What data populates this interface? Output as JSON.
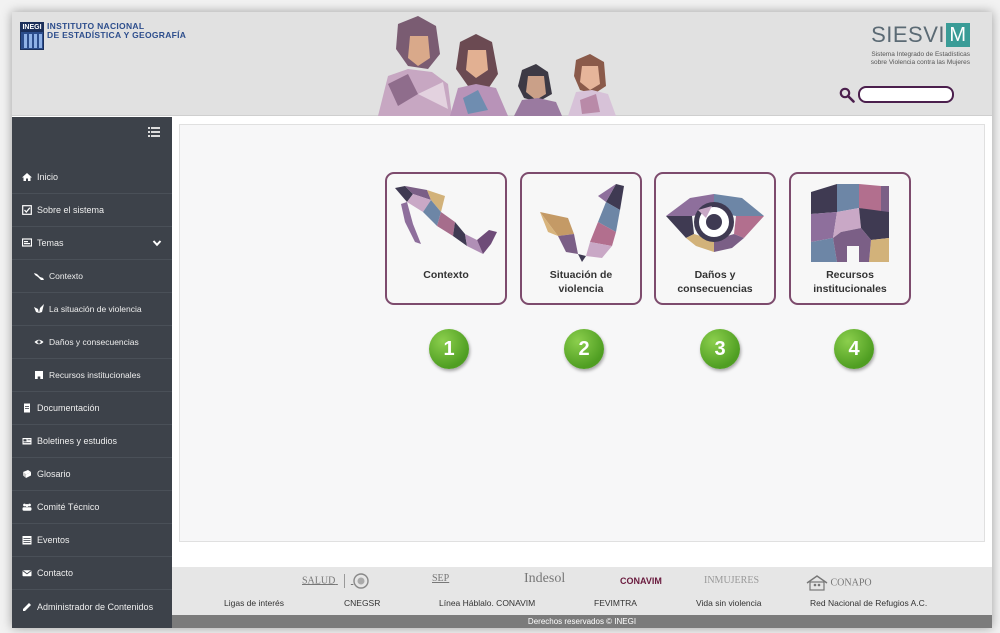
{
  "header": {
    "inegi_line1": "INSTITUTO NACIONAL",
    "inegi_line2": "DE ESTADÍSTICA Y GEOGRAFÍA",
    "inegi_mark": "INEGI",
    "siesvim_title": "SIESVI",
    "siesvim_m": "M",
    "siesvim_sub1": "Sistema Integrado de Estadísticas",
    "siesvim_sub2": "sobre Violencia contra las Mujeres",
    "search_value": "",
    "search_placeholder": ""
  },
  "sidebar": {
    "items": [
      {
        "label": "Inicio",
        "icon": "home-icon"
      },
      {
        "label": "Sobre el sistema",
        "icon": "checkbox-icon"
      },
      {
        "label": "Temas",
        "icon": "topics-icon"
      },
      {
        "label": "Contexto",
        "icon": "map-icon"
      },
      {
        "label": "La situación de violencia",
        "icon": "butterfly-icon"
      },
      {
        "label": "Daños y consecuencias",
        "icon": "eye-icon"
      },
      {
        "label": "Recursos institucionales",
        "icon": "building-icon"
      },
      {
        "label": "Documentación",
        "icon": "document-icon"
      },
      {
        "label": "Boletines y estudios",
        "icon": "newspaper-icon"
      },
      {
        "label": "Glosario",
        "icon": "book-icon"
      },
      {
        "label": "Comité Técnico",
        "icon": "people-icon"
      },
      {
        "label": "Eventos",
        "icon": "calendar-icon"
      },
      {
        "label": "Contacto",
        "icon": "envelope-icon"
      },
      {
        "label": "Administrador de Contenidos",
        "icon": "pencil-icon"
      }
    ]
  },
  "cards": [
    {
      "label_line1": "Contexto",
      "label_line2": "",
      "number": "1"
    },
    {
      "label_line1": "Situación de",
      "label_line2": "violencia",
      "number": "2"
    },
    {
      "label_line1": "Daños y",
      "label_line2": "consecuencias",
      "number": "3"
    },
    {
      "label_line1": "Recursos",
      "label_line2": "institucionales",
      "number": "4"
    }
  ],
  "footer": {
    "logos": [
      "SALUD",
      "SEP",
      "Indesol",
      "CONAVIM",
      "INMUJERES",
      "CONAPO"
    ],
    "links": [
      "Ligas de interés",
      "CNEGSR",
      "Línea Háblalo. CONAVIM",
      "FEVIMTRA",
      "Vida sin violencia",
      "Red Nacional de Refugios A.C."
    ],
    "copyright": "Derechos reservados © INEGI"
  },
  "colors": {
    "card_border": "#7d4b6d",
    "badge_green": "#5aab2a",
    "sidebar_bg": "#3d424a",
    "search_border": "#4b1f4d"
  }
}
